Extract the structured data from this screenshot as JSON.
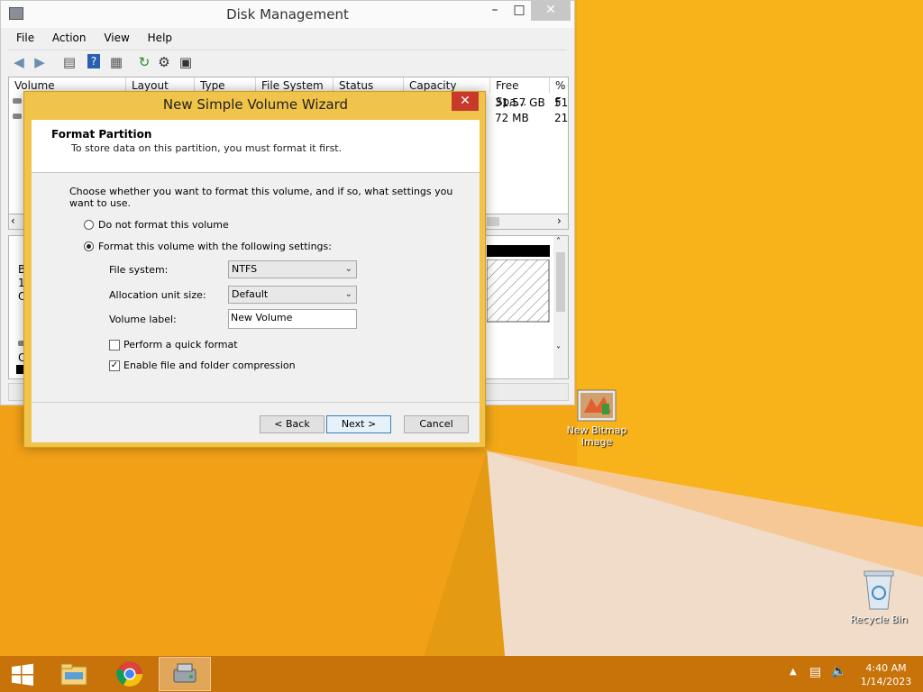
{
  "dm": {
    "title": "Disk Management",
    "menu": [
      "File",
      "Action",
      "View",
      "Help"
    ],
    "columns": [
      "Volume",
      "Layout",
      "Type",
      "File System",
      "Status",
      "Capacity",
      "Free Spa...",
      "% F"
    ],
    "rows": [
      {
        "free": "31.57 GB",
        "pct": "51"
      },
      {
        "free": "72 MB",
        "pct": "21"
      }
    ],
    "bottom_left_chars": [
      "B",
      "1.",
      "O"
    ],
    "bottom_left_chars2": [
      "C"
    ]
  },
  "wizard": {
    "title": "New Simple Volume Wizard",
    "heading": "Format Partition",
    "subheading": "To store data on this partition, you must format it first.",
    "description": "Choose whether you want to format this volume, and if so, what settings you want to use.",
    "radio_no_format": "Do not format this volume",
    "radio_format": "Format this volume with the following settings:",
    "file_system_label": "File system:",
    "file_system_value": "NTFS",
    "alloc_label": "Allocation unit size:",
    "alloc_value": "Default",
    "volume_label_label": "Volume label:",
    "volume_label_value": "New Volume",
    "quick_format": "Perform a quick format",
    "compression": "Enable file and folder compression",
    "back": "< Back",
    "next": "Next >",
    "cancel": "Cancel"
  },
  "desktop": {
    "bitmap_icon_label": "New Bitmap Image",
    "recycle_bin_label": "Recycle Bin"
  },
  "taskbar": {
    "time": "4:40 AM",
    "date": "1/14/2023"
  },
  "icons": {
    "start": "windows-start-icon",
    "explorer": "file-explorer-icon",
    "chrome": "chrome-icon",
    "disk": "disk-management-icon"
  }
}
